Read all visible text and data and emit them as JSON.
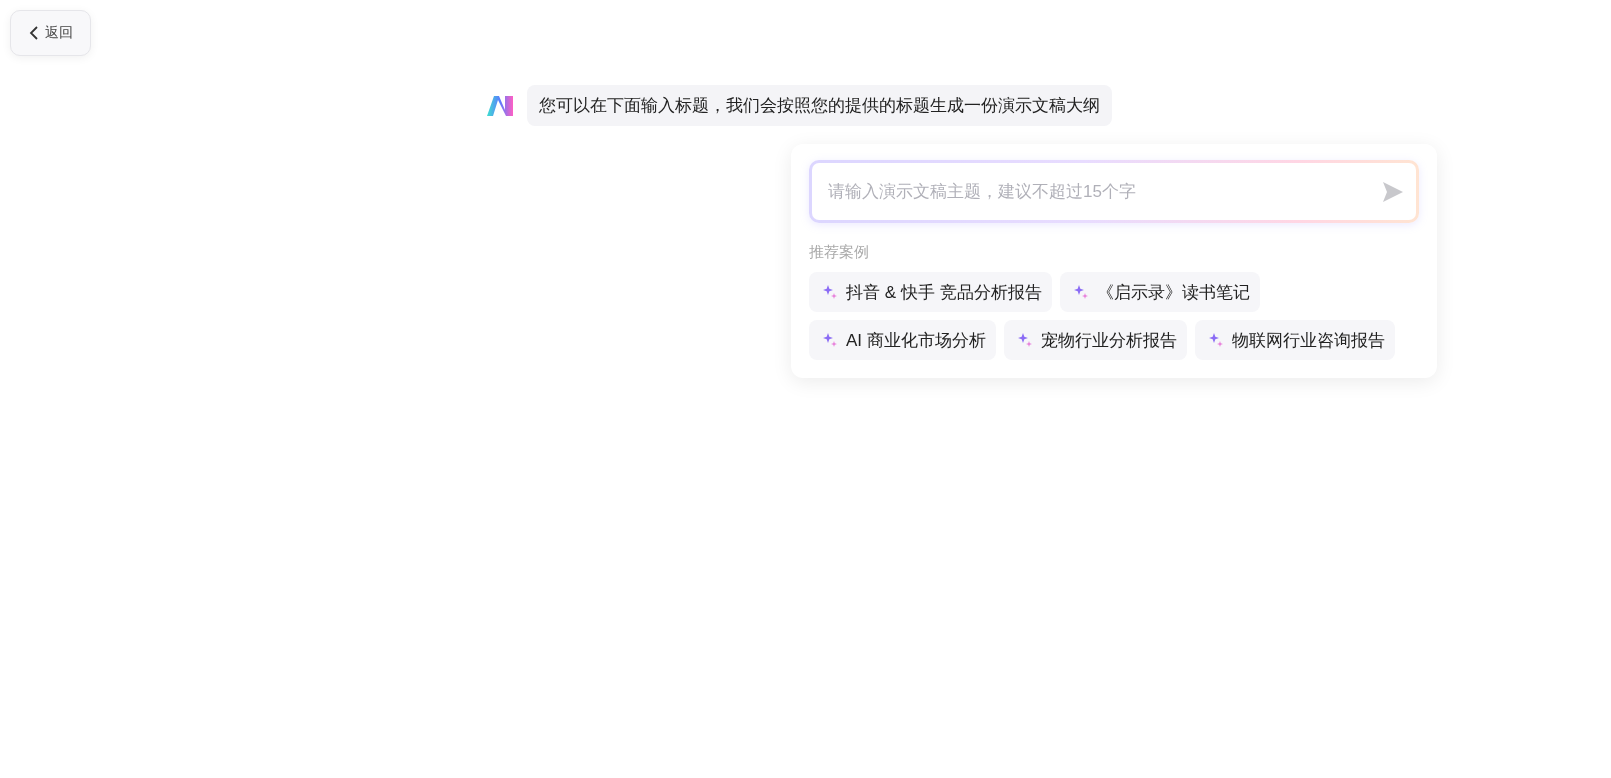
{
  "back_button": {
    "label": "返回"
  },
  "message": {
    "text": "您可以在下面输入标题，我们会按照您的提供的标题生成一份演示文稿大纲"
  },
  "input": {
    "placeholder": "请输入演示文稿主题，建议不超过15个字"
  },
  "suggestions": {
    "title": "推荐案例",
    "rows": [
      [
        "抖音 & 快手 竞品分析报告",
        "《启示录》读书笔记"
      ],
      [
        "AI 商业化市场分析",
        "宠物行业分析报告",
        "物联网行业咨询报告"
      ]
    ]
  }
}
